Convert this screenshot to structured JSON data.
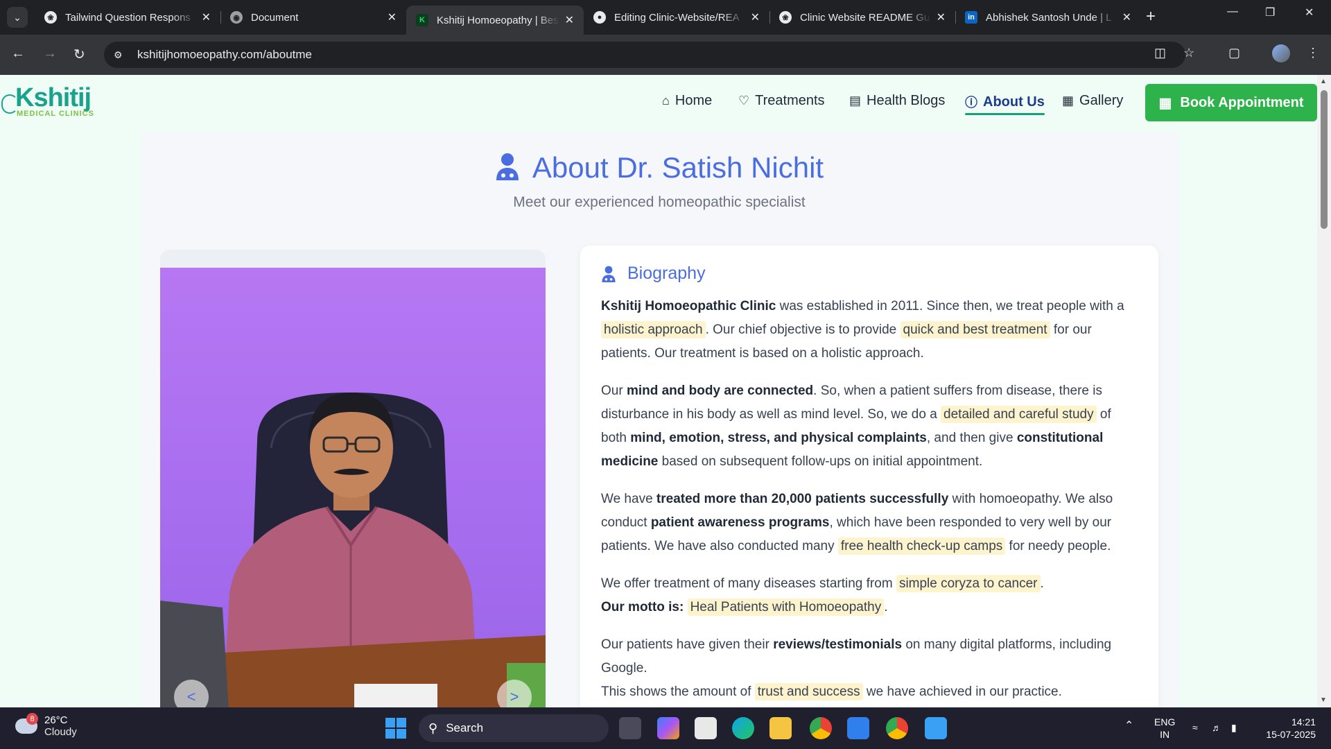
{
  "browser": {
    "tabs": [
      {
        "title": "Tailwind Question Respons",
        "favicon": "chatgpt-icon",
        "active": false
      },
      {
        "title": "Document",
        "favicon": "globe-icon",
        "active": false
      },
      {
        "title": "Kshitij Homoeopathy | Best",
        "favicon": "kshitij-k-icon",
        "active": true
      },
      {
        "title": "Editing Clinic-Website/REA",
        "favicon": "github-icon",
        "active": false
      },
      {
        "title": "Clinic Website README Gu",
        "favicon": "chatgpt-icon",
        "active": false
      },
      {
        "title": "Abhishek Santosh Unde | L",
        "favicon": "linkedin-icon",
        "active": false
      }
    ],
    "url": "kshitijhomoeopathy.com/aboutme"
  },
  "site": {
    "logo": {
      "main": "Kshitij",
      "sub": "MEDICAL CLINICS"
    },
    "nav": [
      {
        "label": "Home",
        "icon": "home-icon",
        "active": false
      },
      {
        "label": "Treatments",
        "icon": "heart-icon",
        "active": false
      },
      {
        "label": "Health Blogs",
        "icon": "document-icon",
        "active": false
      },
      {
        "label": "About Us",
        "icon": "info-icon",
        "active": true
      },
      {
        "label": "Gallery",
        "icon": "image-icon",
        "active": false
      }
    ],
    "book_button": "Book Appointment"
  },
  "about": {
    "title": "About Dr. Satish Nichit",
    "subtitle": "Meet our experienced homeopathic specialist",
    "carousel": {
      "prev": "<",
      "next": ">"
    },
    "bio_heading": "Biography",
    "p1": {
      "b1": "Kshitij Homoeopathic Clinic",
      "t1": " was established in 2011. Since then, we treat people with a ",
      "h1": "holistic approach",
      "t2": ". Our chief objective is to provide ",
      "h2": "quick and best treatment",
      "t3": " for our patients. Our treatment is based on a holistic approach."
    },
    "p2": {
      "t1": "Our ",
      "b1": "mind and body are connected",
      "t2": ". So, when a patient suffers from disease, there is disturbance in his body as well as mind level. So, we do a ",
      "h1": "detailed and careful study",
      "t3": " of both ",
      "b2": "mind, emotion, stress, and physical complaints",
      "t4": ", and then give ",
      "b3": "constitutional medicine",
      "t5": " based on subsequent follow-ups on initial appointment."
    },
    "p3": {
      "t1": "We have ",
      "b1": "treated more than 20,000 patients successfully",
      "t2": " with homoeopathy. We also conduct ",
      "b2": "patient awareness programs",
      "t3": ", which have been responded to very well by our patients. We have also conducted many ",
      "h1": "free health check-up camps",
      "t4": " for needy people."
    },
    "p4": {
      "t1": "We offer treatment of many diseases starting from ",
      "h1": "simple coryza to cancer",
      "t2": ".",
      "b1": "Our motto is:",
      "h2": "Heal Patients with Homoeopathy",
      "t3": "."
    },
    "p5": {
      "t1": "Our patients have given their ",
      "b1": "reviews/testimonials",
      "t2": " on many digital platforms, including Google.",
      "t3": "This shows the amount of ",
      "h1": "trust and success",
      "t4": " we have achieved in our practice."
    }
  },
  "taskbar": {
    "weather_badge": "8",
    "temperature": "26°C",
    "condition": "Cloudy",
    "search": "Search",
    "lang1": "ENG",
    "lang2": "IN",
    "time": "14:21",
    "date": "15-07-2025"
  },
  "colors": {
    "accent": "#4a6ee0",
    "brand": "#1aa38a",
    "book": "#2eb24b",
    "highlight": "#fdf3cd"
  }
}
